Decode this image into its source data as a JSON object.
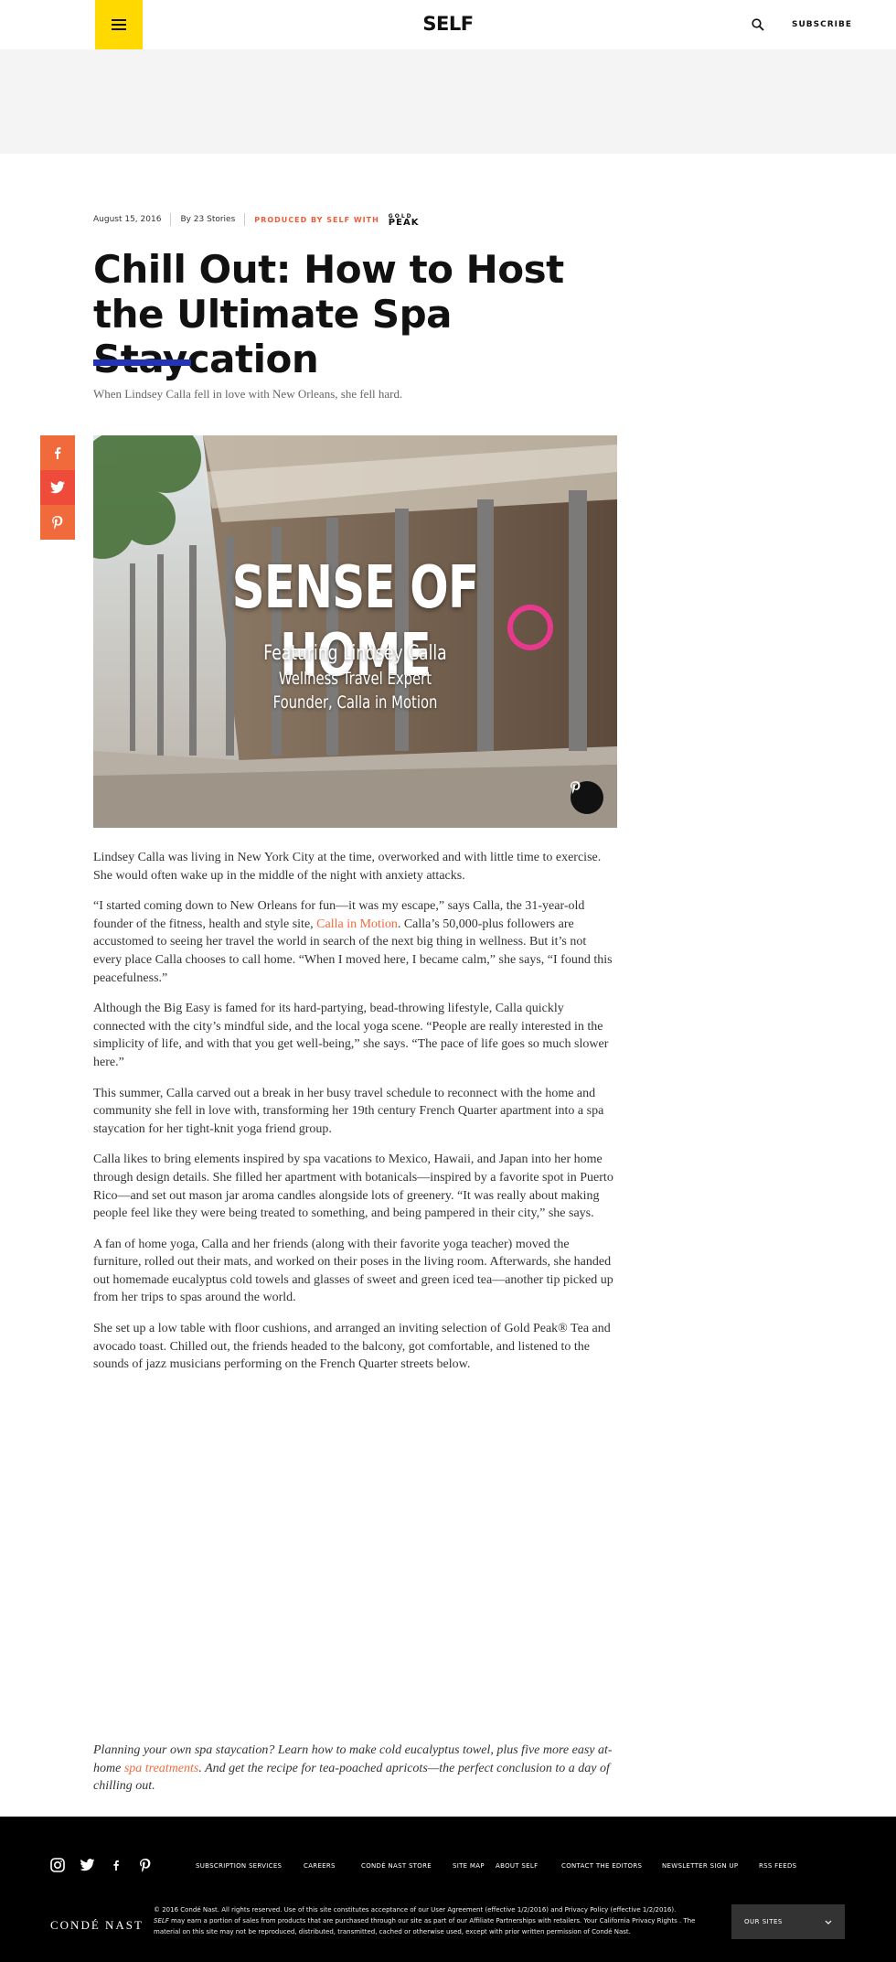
{
  "header": {
    "logo": "SELF",
    "subscribe_label": "SUBSCRIBE",
    "menu_icon": "hamburger-icon",
    "search_icon": "search-icon",
    "menu_color": "#ffd900"
  },
  "byline": {
    "date": "August 15, 2016",
    "author": "By 23 Stories",
    "produced": "PRODUCED BY SELF WITH",
    "sponsor_top": "GOLD",
    "sponsor_main": "PEAK"
  },
  "article": {
    "title": "Chill Out: How to Host the Ultimate Spa Staycation",
    "dek": "When Lindsey Calla fell in love with New Orleans, she fell hard.",
    "rule_color": "#2433b4",
    "hero": {
      "title": "SENSE OF HOME",
      "line1": "Featuring Lindsey Calla",
      "line2": "Wellness Travel Expert",
      "line3": "Founder, Calla in Motion"
    },
    "paragraphs": [
      "Lindsey Calla was living in New York City at the time, overworked and with little time to exercise. She would often wake up in the middle of the night with anxiety attacks.",
      "",
      "Although the Big Easy is famed for its hard-partying, bead-throwing lifestyle, Calla quickly connected with the city’s mindful side, and the local yoga scene. “People are really interested in the simplicity of life, and with that you get well-being,” she says. “The pace of life goes so much slower here.”",
      "This summer, Calla carved out a break in her busy travel schedule to reconnect with the home and community she fell in love with, transforming her 19th century French Quarter apartment into a spa staycation for her tight-knit yoga friend group.",
      "Calla likes to bring elements inspired by spa vacations to Mexico, Hawaii, and Japan into her home through design details. She filled her apartment with botanicals—inspired by a favorite spot in Puerto Rico—and set out mason jar aroma candles alongside lots of greenery. “It was really about making people feel like they were being treated to something, and being pampered in their city,” she says.",
      "A fan of home yoga, Calla and her friends (along with their favorite yoga teacher) moved the furniture, rolled out their mats, and worked on their poses in the living room. Afterwards, she handed out homemade eucalyptus cold towels and glasses of sweet and green iced tea—another tip picked up from her trips to spas around the world.",
      "She set up a low table with floor cushions, and arranged an inviting selection of Gold Peak® Tea and avocado toast. Chilled out, the friends headed to the balcony, got comfortable, and listened to the sounds of jazz musicians performing on the French Quarter streets below."
    ],
    "p2_before": "“I started coming down to New Orleans for fun—it was my escape,” says Calla, the 31-year-old founder of the fitness, health and style site, ",
    "p2_link": "Calla in Motion",
    "p2_after": ". Calla’s 50,000-plus followers are accustomed to seeing her travel the world in search of the next big thing in wellness. But it’s not every place Calla chooses to call home. “When I moved here, I became calm,” she says, “I found this peacefulness.”",
    "footnote_before": "Planning your own spa staycation? Learn how to make cold eucalyptus towel, plus five more easy at-home ",
    "footnote_link": "spa treatments",
    "footnote_after": ". And get the recipe for tea-poached apricots—the perfect conclusion to a day of chilling out."
  },
  "social": [
    "facebook-icon",
    "twitter-icon",
    "pinterest-icon"
  ],
  "footer": {
    "links": [
      "SUBSCRIPTION SERVICES",
      "CAREERS",
      "CONDÉ NAST STORE",
      "SITE MAP",
      "ABOUT SELF",
      "CONTACT THE EDITORS",
      "NEWSLETTER SIGN UP",
      "RSS FEEDS"
    ],
    "brand": "CONDÉ NAST",
    "legal_1": "© 2016 Condé Nast. All rights reserved. Use of this site constitutes acceptance of our  User Agreement (effective 1/2/2016) and  Privacy Policy  (effective 1/2/2016).",
    "legal_self": "SELF",
    "legal_2": " may earn a portion of sales from products that are purchased through our site as part of our Affiliate Partnerships with retailers.  Your California Privacy Rights . The material on this site may not be reproduced, distributed, transmitted, cached or otherwise used, except with prior written permission of Condé Nast.",
    "our_sites": "OUR SITES"
  }
}
